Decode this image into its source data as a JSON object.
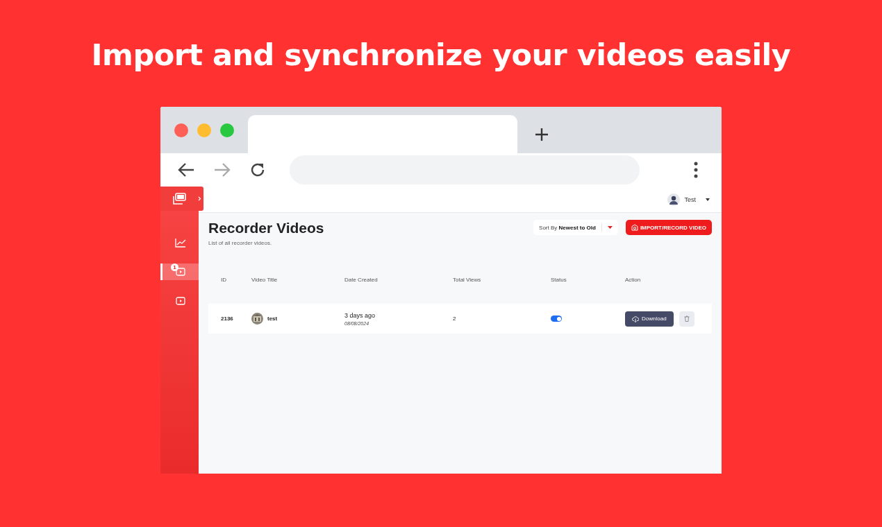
{
  "headline": "Import and synchronize your videos easily",
  "sidebar": {
    "items": [
      {
        "kind": "chart",
        "selected": false
      },
      {
        "kind": "video",
        "selected": true,
        "badge": "1"
      },
      {
        "kind": "play",
        "selected": false
      }
    ]
  },
  "user": {
    "name": "Test"
  },
  "page": {
    "title": "Recorder Videos",
    "subtitle": "List of all recorder videos."
  },
  "sort": {
    "label": "Sort By **Newest to Old**"
  },
  "import_button": "IMPORT/RECORD VIDEO",
  "table": {
    "columns": [
      "ID",
      "Video Title",
      "Date Created",
      "Total Views",
      "Status",
      "Action"
    ],
    "rows": [
      {
        "id": "2136",
        "title": "test",
        "created": "3 days ago",
        "date": "08/08/2024",
        "views": "2",
        "status_on": true,
        "action": "Download"
      }
    ]
  }
}
